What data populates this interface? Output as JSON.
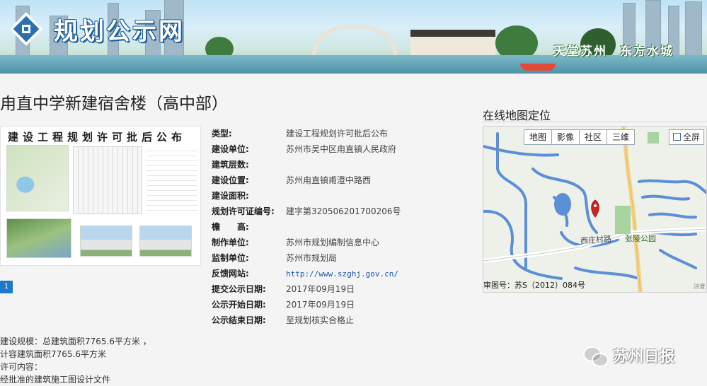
{
  "banner": {
    "logo_text": "规划公示网",
    "slogan_1": "天堂苏州",
    "slogan_2": "东方水城"
  },
  "page": {
    "title": "甪直中学新建宿舍楼（高中部）"
  },
  "gallery": {
    "heading": "建设工程规划许可批后公布",
    "current_page": "1"
  },
  "info": {
    "rows": [
      {
        "label": "类型:",
        "value": "建设工程规划许可批后公布"
      },
      {
        "label": "建设单位:",
        "value": "苏州市吴中区甪直镇人民政府"
      },
      {
        "label": "建筑层数:",
        "value": ""
      },
      {
        "label": "建设位置:",
        "value": "苏州甪直镇甫澄中路西"
      },
      {
        "label": "建设面积:",
        "value": ""
      },
      {
        "label": "规划许可证编号:",
        "value": "建字第320506201700206号"
      },
      {
        "label": "檐　　高:",
        "value": ""
      },
      {
        "label": "制作单位:",
        "value": "苏州市规划编制信息中心"
      },
      {
        "label": "监制单位:",
        "value": "苏州市规划局"
      },
      {
        "label": "反馈网站:",
        "value": "http://www.szghj.gov.cn/"
      },
      {
        "label": "提交公示日期:",
        "value": "2017年09月19日"
      },
      {
        "label": "公示开始日期:",
        "value": "2017年09月19日"
      },
      {
        "label": "公示结束日期:",
        "value": "至规划核实合格止"
      }
    ]
  },
  "map": {
    "title": "在线地图定位",
    "tabs": [
      "地图",
      "影像",
      "社区",
      "三维"
    ],
    "fullscreen": "全屏",
    "road_label": "西庄村路",
    "park_label": "张陵公园",
    "copyright": "审图号：苏S（2012）084号",
    "corner_text": "浒澄"
  },
  "bottom": {
    "line1": "建设规模：总建筑面积7765.6平方米 ，",
    "line2": "计容建筑面积7765.6平方米",
    "line3": "许可内容：",
    "line4": "经批准的建筑施工图设计文件"
  },
  "watermark": {
    "text": "苏州日报"
  },
  "colors": {
    "accent_blue": "#1f78c8",
    "link_blue": "#1a56b0",
    "map_water": "#5b8fd6",
    "marker_red": "#d62020"
  }
}
